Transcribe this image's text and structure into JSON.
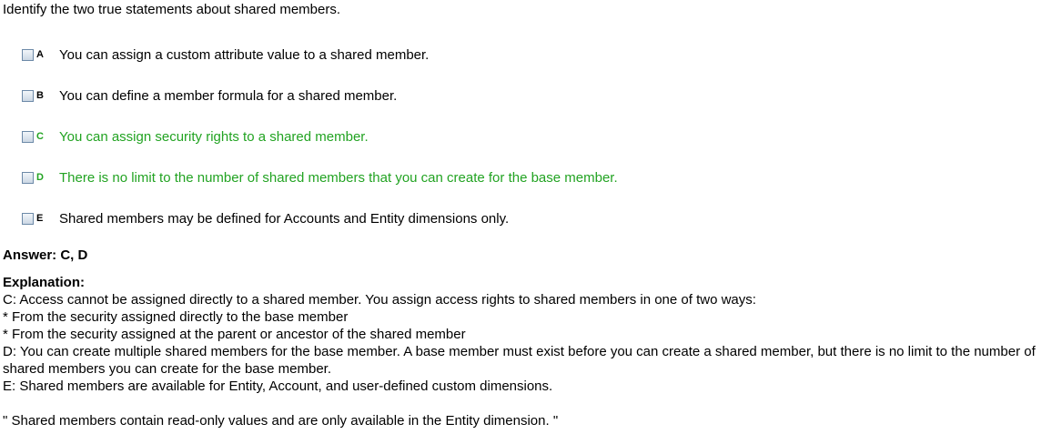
{
  "question": "Identify the two true statements about shared members.",
  "options": [
    {
      "letter": "A",
      "text": "You can assign a custom attribute value to a shared member.",
      "correct": false
    },
    {
      "letter": "B",
      "text": "You can define a member formula for a shared member.",
      "correct": false
    },
    {
      "letter": "C",
      "text": "You can assign security rights to a shared member.",
      "correct": true
    },
    {
      "letter": "D",
      "text": "There is no limit to the number of shared members that you can create for the base member.",
      "correct": true
    },
    {
      "letter": "E",
      "text": "Shared members may be defined for Accounts and Entity dimensions only.",
      "correct": false
    }
  ],
  "answer": "Answer: C, D",
  "explanation": {
    "title": "Explanation:",
    "lines": [
      "C: Access cannot be assigned directly to a shared member. You assign access rights to shared members in one of two ways:",
      "* From the security assigned directly to the base member",
      "* From the security assigned at the parent or ancestor of the shared member",
      "D: You can create multiple shared members for the base member. A base member must exist before you can create a shared member, but there is no limit to the number of shared members you can create for the base member.",
      "E: Shared members are available for Entity, Account, and user-defined custom dimensions."
    ]
  },
  "quote": "\" Shared members contain read-only values and are only available in the Entity dimension. \"",
  "colors": {
    "correct_text": "#22a322",
    "default_text": "#000000"
  }
}
